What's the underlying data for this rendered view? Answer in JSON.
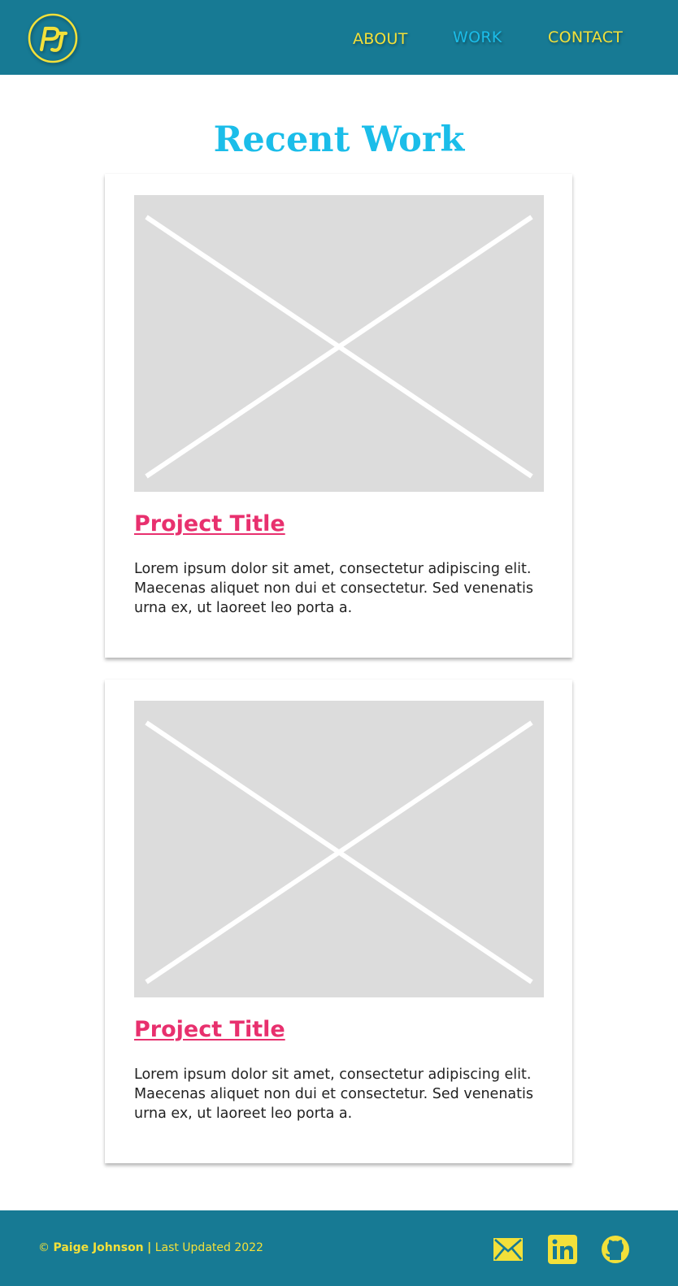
{
  "colors": {
    "header_bg": "#177a94",
    "accent_yellow": "#f2e03a",
    "active_blue": "#1bbde9",
    "title_blue": "#1bbde9",
    "project_pink": "#e8306e",
    "placeholder_gray": "#dcdcdc"
  },
  "header": {
    "logo_icon": "pj-monogram-logo",
    "logo_text": "PJ",
    "nav": {
      "about": "ABOUT",
      "work": "WORK",
      "contact": "CONTACT"
    },
    "active_nav": "work"
  },
  "main": {
    "title": "Recent Work",
    "projects": [
      {
        "image_icon": "image-placeholder-icon",
        "title": "Project Title",
        "description": "Lorem ipsum dolor sit amet, consectetur adipiscing elit. Maecenas aliquet non dui et consectetur. Sed venenatis urna ex, ut laoreet leo porta a."
      },
      {
        "image_icon": "image-placeholder-icon",
        "title": "Project Title",
        "description": "Lorem ipsum dolor sit amet, consectetur adipiscing elit. Maecenas aliquet non dui et consectetur. Sed venenatis urna ex, ut laoreet leo porta a."
      }
    ]
  },
  "footer": {
    "copyright_symbol": "©",
    "name": "Paige Johnson",
    "separator": "|",
    "updated": "Last Updated 2022",
    "icons": [
      "mail-icon",
      "linkedin-icon",
      "github-icon"
    ]
  }
}
